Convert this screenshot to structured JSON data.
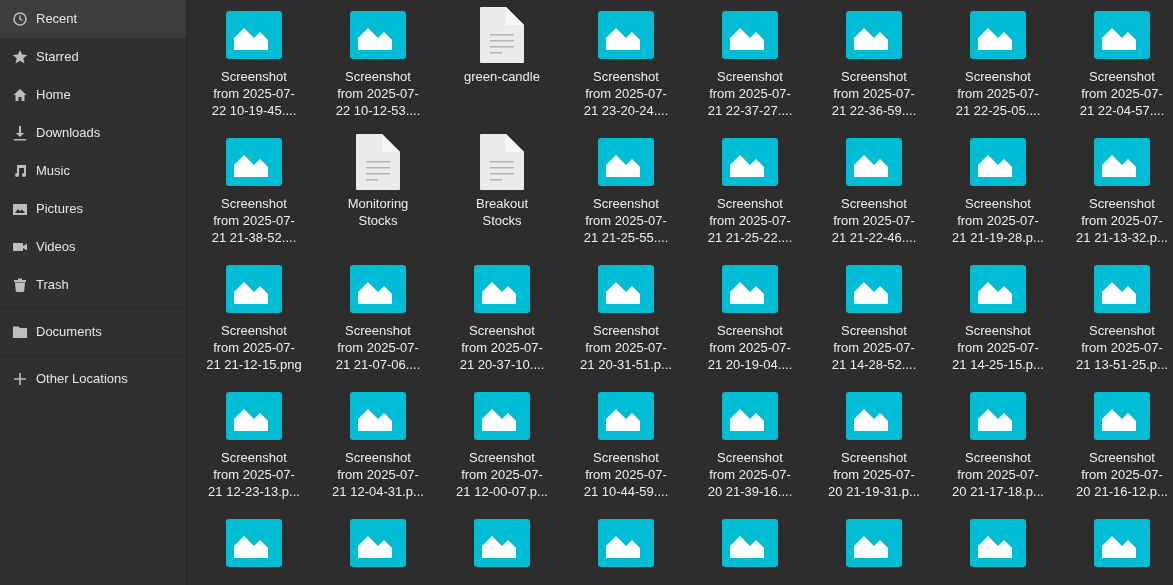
{
  "sidebar": {
    "sections": [
      {
        "items": [
          {
            "label": "Recent",
            "selected": true
          },
          {
            "label": "Starred",
            "selected": false
          },
          {
            "label": "Home",
            "selected": false
          },
          {
            "label": "Downloads",
            "selected": false
          },
          {
            "label": "Music",
            "selected": false
          },
          {
            "label": "Pictures",
            "selected": false
          },
          {
            "label": "Videos",
            "selected": false
          },
          {
            "label": "Trash",
            "selected": false
          }
        ]
      },
      {
        "items": [
          {
            "label": "Documents",
            "selected": false
          }
        ]
      },
      {
        "items": [
          {
            "label": "Other Locations",
            "selected": false
          }
        ]
      }
    ]
  },
  "files": [
    {
      "kind": "image",
      "label_lines": [
        "Screenshot",
        "from 2025-07-",
        "22 10-19-45...."
      ]
    },
    {
      "kind": "image",
      "label_lines": [
        "Screenshot",
        "from 2025-07-",
        "22 10-12-53...."
      ]
    },
    {
      "kind": "document",
      "label_lines": [
        "green-candle"
      ]
    },
    {
      "kind": "image",
      "label_lines": [
        "Screenshot",
        "from 2025-07-",
        "21 23-20-24...."
      ]
    },
    {
      "kind": "image",
      "label_lines": [
        "Screenshot",
        "from 2025-07-",
        "21 22-37-27...."
      ]
    },
    {
      "kind": "image",
      "label_lines": [
        "Screenshot",
        "from 2025-07-",
        "21 22-36-59...."
      ]
    },
    {
      "kind": "image",
      "label_lines": [
        "Screenshot",
        "from 2025-07-",
        "21 22-25-05...."
      ]
    },
    {
      "kind": "image",
      "label_lines": [
        "Screenshot",
        "from 2025-07-",
        "21 22-04-57...."
      ]
    },
    {
      "kind": "image",
      "label_lines": [
        "Screenshot",
        "from 2025-07-",
        "21 21-38-52...."
      ]
    },
    {
      "kind": "document",
      "label_lines": [
        "Monitoring",
        "Stocks"
      ]
    },
    {
      "kind": "document",
      "label_lines": [
        "Breakout",
        "Stocks"
      ]
    },
    {
      "kind": "image",
      "label_lines": [
        "Screenshot",
        "from 2025-07-",
        "21 21-25-55...."
      ]
    },
    {
      "kind": "image",
      "label_lines": [
        "Screenshot",
        "from 2025-07-",
        "21 21-25-22...."
      ]
    },
    {
      "kind": "image",
      "label_lines": [
        "Screenshot",
        "from 2025-07-",
        "21 21-22-46...."
      ]
    },
    {
      "kind": "image",
      "label_lines": [
        "Screenshot",
        "from 2025-07-",
        "21 21-19-28.p..."
      ]
    },
    {
      "kind": "image",
      "label_lines": [
        "Screenshot",
        "from 2025-07-",
        "21 21-13-32.p..."
      ]
    },
    {
      "kind": "image",
      "label_lines": [
        "Screenshot",
        "from 2025-07-",
        "21 21-12-15.png"
      ]
    },
    {
      "kind": "image",
      "label_lines": [
        "Screenshot",
        "from 2025-07-",
        "21 21-07-06...."
      ]
    },
    {
      "kind": "image",
      "label_lines": [
        "Screenshot",
        "from 2025-07-",
        "21 20-37-10...."
      ]
    },
    {
      "kind": "image",
      "label_lines": [
        "Screenshot",
        "from 2025-07-",
        "21 20-31-51.p..."
      ]
    },
    {
      "kind": "image",
      "label_lines": [
        "Screenshot",
        "from 2025-07-",
        "21 20-19-04...."
      ]
    },
    {
      "kind": "image",
      "label_lines": [
        "Screenshot",
        "from 2025-07-",
        "21 14-28-52...."
      ]
    },
    {
      "kind": "image",
      "label_lines": [
        "Screenshot",
        "from 2025-07-",
        "21 14-25-15.p..."
      ]
    },
    {
      "kind": "image",
      "label_lines": [
        "Screenshot",
        "from 2025-07-",
        "21 13-51-25.p..."
      ]
    },
    {
      "kind": "image",
      "label_lines": [
        "Screenshot",
        "from 2025-07-",
        "21 12-23-13.p..."
      ]
    },
    {
      "kind": "image",
      "label_lines": [
        "Screenshot",
        "from 2025-07-",
        "21 12-04-31.p..."
      ]
    },
    {
      "kind": "image",
      "label_lines": [
        "Screenshot",
        "from 2025-07-",
        "21 12-00-07.p..."
      ]
    },
    {
      "kind": "image",
      "label_lines": [
        "Screenshot",
        "from 2025-07-",
        "21 10-44-59...."
      ]
    },
    {
      "kind": "image",
      "label_lines": [
        "Screenshot",
        "from 2025-07-",
        "20 21-39-16...."
      ]
    },
    {
      "kind": "image",
      "label_lines": [
        "Screenshot",
        "from 2025-07-",
        "20 21-19-31.p..."
      ]
    },
    {
      "kind": "image",
      "label_lines": [
        "Screenshot",
        "from 2025-07-",
        "20 21-17-18.p..."
      ]
    },
    {
      "kind": "image",
      "label_lines": [
        "Screenshot",
        "from 2025-07-",
        "20 21-16-12.p..."
      ]
    },
    {
      "kind": "image"
    },
    {
      "kind": "image"
    },
    {
      "kind": "image"
    },
    {
      "kind": "image"
    },
    {
      "kind": "image"
    },
    {
      "kind": "image"
    },
    {
      "kind": "image"
    },
    {
      "kind": "image"
    }
  ]
}
